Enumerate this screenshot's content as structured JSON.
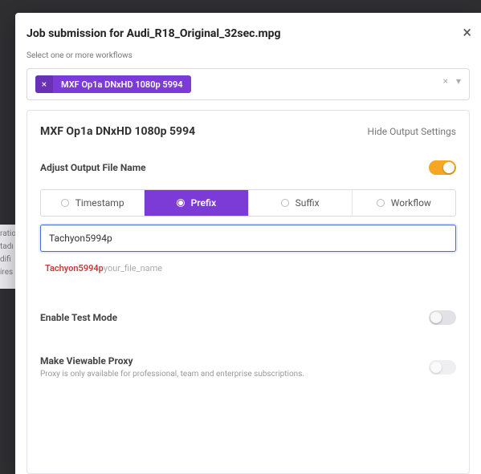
{
  "modal": {
    "title": "Job submission for Audi_R18_Original_32sec.mpg",
    "close_glyph": "×"
  },
  "subtitle": "Select one or more workflows",
  "selected_workflow": {
    "label": "MXF Op1a DNxHD 1080p 5994",
    "remove_glyph": "×"
  },
  "select_controls": {
    "clear": "×",
    "caret": "▾"
  },
  "panel": {
    "title": "MXF Op1a DNxHD 1080p 5994",
    "hide_label": "Hide Output Settings"
  },
  "adjust": {
    "label": "Adjust Output File Name",
    "enabled": true,
    "options": {
      "timestamp": "Timestamp",
      "prefix": "Prefix",
      "suffix": "Suffix",
      "workflow": "Workflow"
    },
    "selected": "prefix",
    "input_value": "Tachyon5994p",
    "preview_prefix": "Tachyon5994p",
    "preview_rest": "your_file_name"
  },
  "test_mode": {
    "label": "Enable Test Mode",
    "enabled": false
  },
  "proxy": {
    "label": "Make Viewable Proxy",
    "sub": "Proxy is only available for professional, team and enterprise subscriptions.",
    "enabled": false,
    "disabled": true
  },
  "sidebar_fragment": [
    "ratio",
    "tadı",
    "difi",
    "ires"
  ]
}
